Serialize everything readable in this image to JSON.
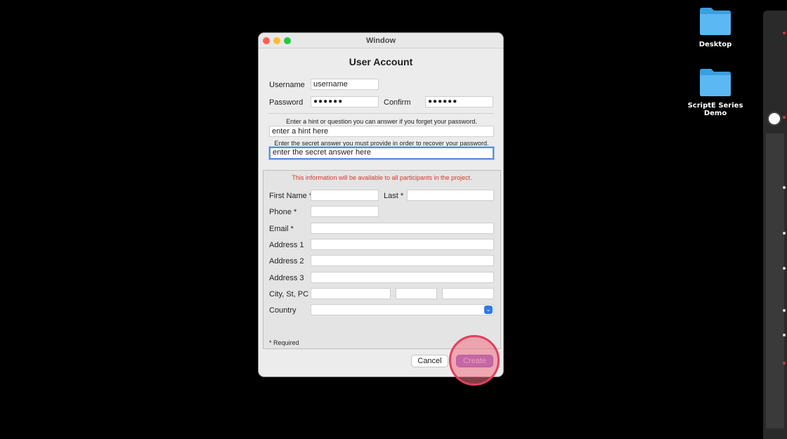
{
  "desktop": {
    "icons": [
      {
        "label": "Desktop",
        "icon": "folder-icon"
      },
      {
        "label": "ScriptE Series Demo",
        "icon": "folder-icon"
      }
    ]
  },
  "window": {
    "title": "Window",
    "heading": "User Account",
    "username": {
      "label": "Username",
      "value": "username"
    },
    "password": {
      "label": "Password",
      "value": "●●●●●●"
    },
    "confirm": {
      "label": "Confirm",
      "value": "●●●●●●"
    },
    "hint_prompt": "Enter a hint or question you can answer if you forget your password.",
    "hint_value": "enter a hint here",
    "answer_prompt": "Enter the secret answer you must provide in order to recover your password.",
    "answer_value": "enter the secret answer here",
    "notice": "This information will be available to all participants in the project.",
    "first_name_label": "First Name *",
    "last_label": "Last *",
    "phone_label": "Phone *",
    "email_label": "Email *",
    "address1_label": "Address 1",
    "address2_label": "Address 2",
    "address3_label": "Address 3",
    "city_label": "City, St, PC",
    "country_label": "Country",
    "required_note": "* Required",
    "cancel_label": "Cancel",
    "create_label": "Create"
  },
  "colors": {
    "accent": "#2f7ae5",
    "create_button": "#8f5fd0",
    "notice_text": "#d23a2a",
    "click_highlight": "#e0405e"
  }
}
